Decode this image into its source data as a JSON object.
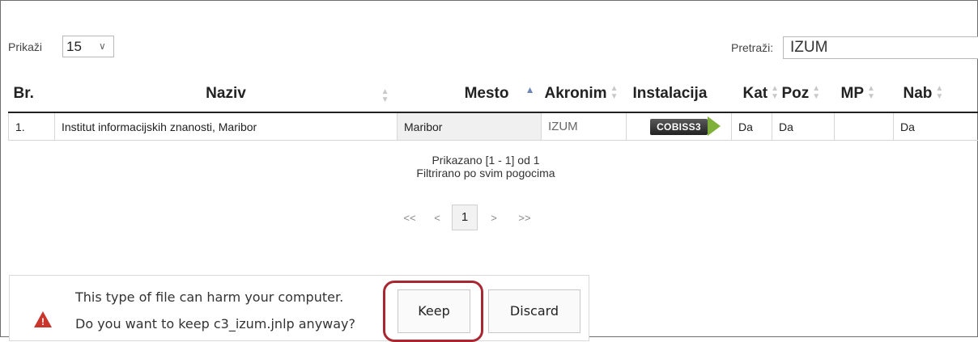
{
  "controls": {
    "show_label": "Prikaži",
    "show_value": "15",
    "search_label": "Pretraži:",
    "search_value": "IZUM"
  },
  "table": {
    "headers": [
      "Br.",
      "Naziv",
      "Mesto",
      "Akronim",
      "Instalacija",
      "Kat",
      "Poz",
      "MP",
      "Nab"
    ],
    "sorted_column": "Mesto",
    "rows": [
      {
        "br": "1.",
        "naziv": "Institut informacijskih znanosti, Maribor",
        "mesto": "Maribor",
        "akronim": "IZUM",
        "instalacija": "COBISS3",
        "kat": "Da",
        "poz": "Da",
        "mp": "",
        "nab": "Da"
      }
    ]
  },
  "info": {
    "line1": "Prikazano [1 - 1] od 1",
    "line2": "Filtrirano po svim pogocima"
  },
  "pager": {
    "first": "<<",
    "prev": "<",
    "current": "1",
    "next": ">",
    "last": ">>"
  },
  "download_bar": {
    "line1": "This type of file can harm your computer.",
    "line2": "Do you want to keep c3_izum.jnlp anyway?",
    "keep_label": "Keep",
    "discard_label": "Discard",
    "warning_icon": "warning-triangle-icon",
    "highlight_color": "#a82731"
  }
}
